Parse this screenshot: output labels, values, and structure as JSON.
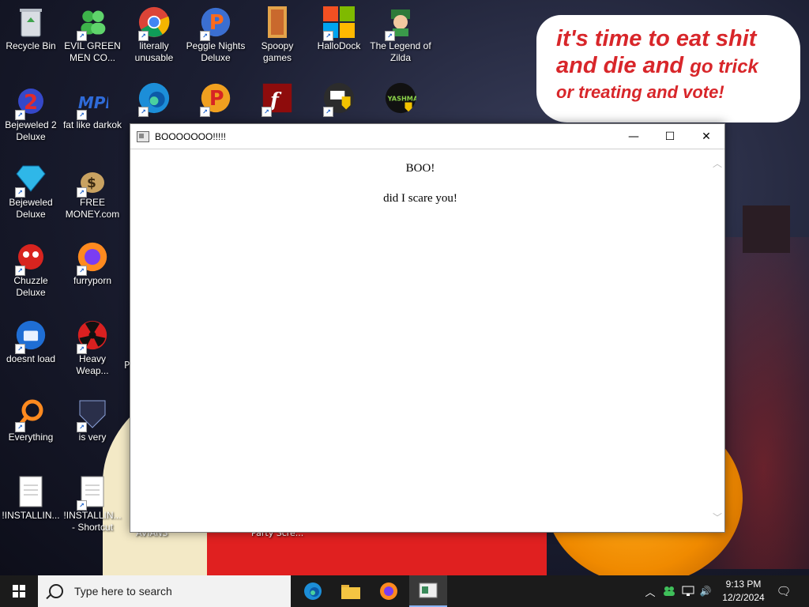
{
  "desktop_icons": [
    {
      "label": "Recycle Bin"
    },
    {
      "label": "EVIL GREEN MEN CO..."
    },
    {
      "label": "literally unusable"
    },
    {
      "label": "Peggle Nights Deluxe"
    },
    {
      "label": "Spoopy games"
    },
    {
      "label": "HalloDock"
    },
    {
      "label": "The Legend of Zilda"
    },
    {
      "label": "Bejeweled 2 Deluxe"
    },
    {
      "label": "fat like darkok"
    },
    {
      "label": ""
    },
    {
      "label": ""
    },
    {
      "label": ""
    },
    {
      "label": ""
    },
    {
      "label": ""
    },
    {
      "label": "Bejeweled Deluxe"
    },
    {
      "label": "FREE MONEY.com"
    },
    {
      "label": "Chuzzle Deluxe"
    },
    {
      "label": "furryporn"
    },
    {
      "label": "doesnt load"
    },
    {
      "label": "Heavy Weap..."
    },
    {
      "label": "Everything"
    },
    {
      "label": "is very"
    },
    {
      "label": "!INSTALLIN..."
    },
    {
      "label": "!INSTALLIN... - Shortcut"
    }
  ],
  "partial_labels": {
    "p": "P",
    "avians": "AVIANS",
    "party": "Party Scre..."
  },
  "icon_texts": {
    "yashma": "YASHMA",
    "dollar": "$",
    "mpl": "MPL"
  },
  "sticker": {
    "line1": "it's time to eat shit",
    "line2a": "and die and",
    "line2b": "go trick",
    "line3": "or treating and vote!"
  },
  "window": {
    "title": "BOOOOOOO!!!!!",
    "line1": "BOO!",
    "line2": "did I scare you!",
    "min_glyph": "—",
    "max_glyph": "☐",
    "close_glyph": "✕",
    "scroll_up": "︿",
    "scroll_down": "﹀"
  },
  "taskbar": {
    "search_placeholder": "Type here to search",
    "time": "9:13 PM",
    "date": "12/2/2024",
    "tray_chevron": "︿",
    "tray_speaker": "🔊",
    "notification_glyph": "🗨"
  },
  "colors": {
    "sticker_text": "#d8262a",
    "taskbar_bg": "#1b1b1b",
    "search_bg": "#f2f2f2"
  }
}
